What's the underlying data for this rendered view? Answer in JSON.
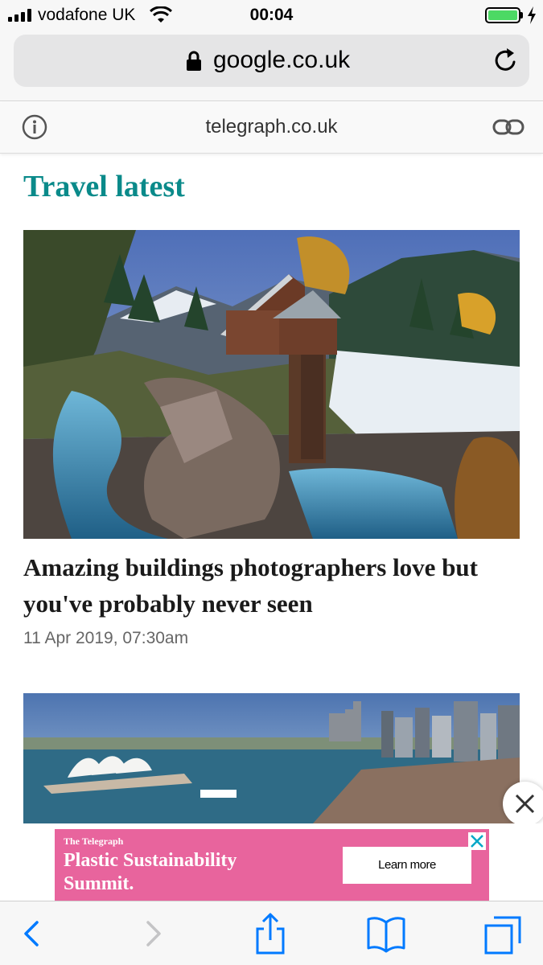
{
  "status_bar": {
    "carrier": "vodafone UK",
    "time": "00:04",
    "signal_bars": 4,
    "battery_level": 1.0,
    "icons": [
      "signal-icon",
      "wifi-icon",
      "battery-icon",
      "charging-icon"
    ]
  },
  "url_bar": {
    "url": "google.co.uk",
    "icons": [
      "lock-icon",
      "reload-icon"
    ]
  },
  "site_bar": {
    "site": "telegraph.co.uk",
    "icons": [
      "info-icon",
      "link-icon"
    ]
  },
  "content": {
    "section_title": "Travel latest",
    "articles": [
      {
        "headline": "Amazing buildings photographers love but you've probably never seen",
        "date": "11 Apr 2019, 07:30am"
      }
    ]
  },
  "ad": {
    "brand": "The Telegraph",
    "title": "Plastic Sustainability Summit.",
    "cta": "Learn more",
    "color": "#e8649d"
  },
  "toolbar": {
    "icons": [
      "back-icon",
      "forward-icon",
      "share-icon",
      "bookmarks-icon",
      "tabs-icon"
    ]
  },
  "colors": {
    "accent": "#0a8a8a",
    "ios_blue": "#007aff"
  }
}
